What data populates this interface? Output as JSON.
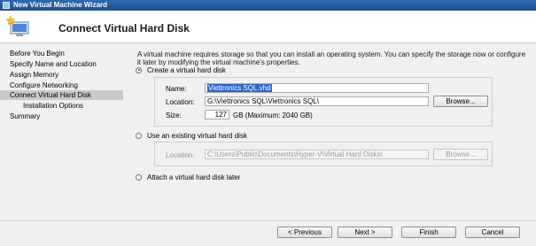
{
  "window": {
    "title": "New Virtual Machine Wizard"
  },
  "header": {
    "title": "Connect Virtual Hard Disk"
  },
  "nav": {
    "items": [
      {
        "label": "Before You Begin"
      },
      {
        "label": "Specify Name and Location"
      },
      {
        "label": "Assign Memory"
      },
      {
        "label": "Configure Networking"
      },
      {
        "label": "Connect Virtual Hard Disk",
        "selected": true
      },
      {
        "label": "Installation Options",
        "sub": true
      },
      {
        "label": "Summary"
      }
    ]
  },
  "main": {
    "description": "A virtual machine requires storage so that you can install an operating system. You can specify the storage now or configure it later by modifying the virtual machine's properties.",
    "create": {
      "radio_label": "Create a virtual hard disk",
      "name_label": "Name:",
      "name_value": "Viettronics SQL.vhd",
      "location_label": "Location:",
      "location_value": "G:\\Viettronics SQL\\Viettronics SQL\\",
      "browse_label": "Browse...",
      "size_label": "Size:",
      "size_value": "127",
      "size_note": "GB (Maximum: 2040 GB)"
    },
    "existing": {
      "radio_label": "Use an existing virtual hard disk",
      "location_label": "Location:",
      "location_value": "C:\\Users\\Public\\Documents\\Hyper-V\\Virtual Hard Disks\\",
      "browse_label": "Browse..."
    },
    "later": {
      "radio_label": "Attach a virtual hard disk later"
    }
  },
  "footer": {
    "previous_label": "< Previous",
    "next_label": "Next >",
    "finish_label": "Finish",
    "cancel_label": "Cancel"
  },
  "colors": {
    "selection": "#3165c5",
    "titlebar": "#1f4e8c",
    "nav_selected": "#c9c9c9"
  }
}
